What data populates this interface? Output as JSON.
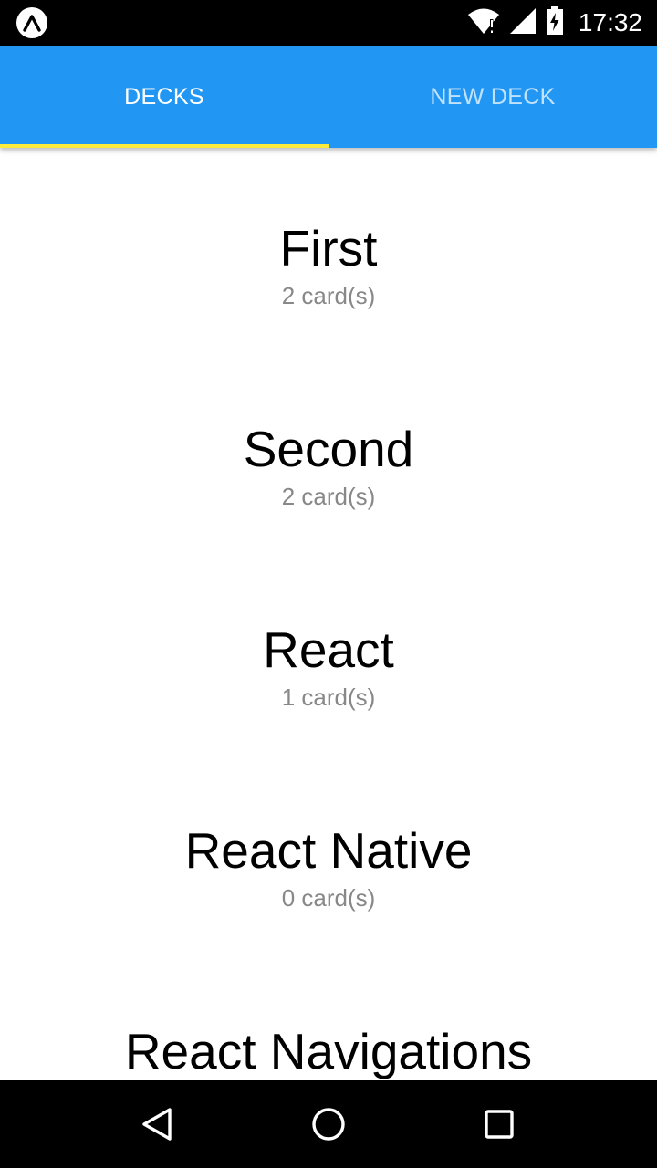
{
  "status_bar": {
    "time": "17:32",
    "icons": [
      "expo-icon",
      "wifi-icon",
      "signal-icon",
      "battery-charging-icon"
    ]
  },
  "tabs": [
    {
      "label": "DECKS",
      "active": true
    },
    {
      "label": "NEW DECK",
      "active": false
    }
  ],
  "colors": {
    "tab_bar": "#2196f3",
    "tab_indicator": "#ffeb3b",
    "subtitle": "#888888"
  },
  "decks": [
    {
      "title": "First",
      "count": "2 card(s)"
    },
    {
      "title": "Second",
      "count": "2 card(s)"
    },
    {
      "title": "React",
      "count": "1 card(s)"
    },
    {
      "title": "React Native",
      "count": "0 card(s)"
    },
    {
      "title": "React Navigations",
      "count": ""
    }
  ],
  "nav_bar": {
    "buttons": [
      "back-icon",
      "home-icon",
      "recents-icon"
    ]
  }
}
